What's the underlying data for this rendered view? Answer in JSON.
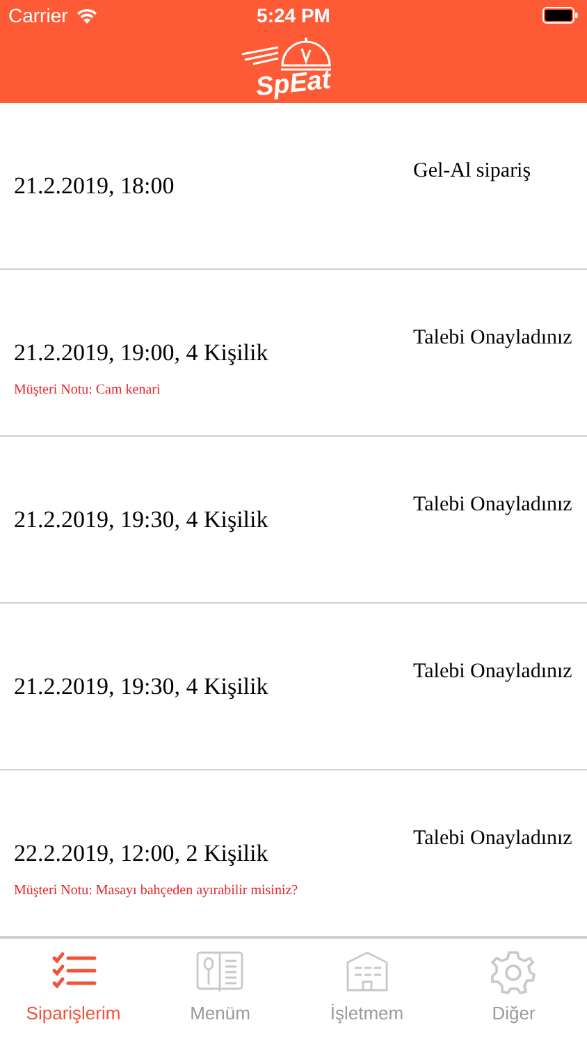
{
  "status_bar": {
    "carrier": "Carrier",
    "time": "5:24 PM"
  },
  "header": {
    "logo_text": "SpEat"
  },
  "orders": [
    {
      "datetime": "21.2.2019, 18:00",
      "status": "Gel-Al sipariş"
    },
    {
      "datetime": "21.2.2019, 19:00, 4 Kişilik",
      "status": "Talebi Onayladınız",
      "note": "Müşteri Notu: Cam kenari"
    },
    {
      "datetime": "21.2.2019, 19:30, 4 Kişilik",
      "status": "Talebi Onayladınız"
    },
    {
      "datetime": "21.2.2019, 19:30, 4 Kişilik",
      "status": "Talebi Onayladınız"
    },
    {
      "datetime": "22.2.2019, 12:00, 2 Kişilik",
      "status": "Talebi Onayladınız",
      "note": "Müşteri Notu: Masayı bahçeden ayırabilir misiniz?"
    }
  ],
  "tabs": [
    {
      "kind": "list",
      "label": "Siparişlerim",
      "selected": true
    },
    {
      "kind": "menu",
      "label": "Menüm",
      "selected": false
    },
    {
      "kind": "building",
      "label": "İşletmem",
      "selected": false
    },
    {
      "kind": "gear",
      "label": "Diğer",
      "selected": false
    }
  ]
}
